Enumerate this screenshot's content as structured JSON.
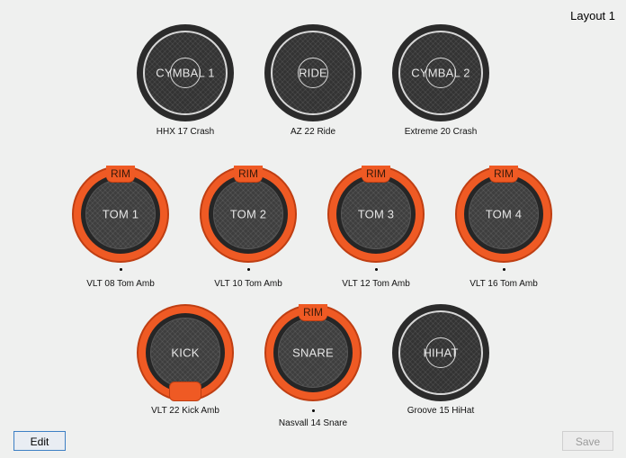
{
  "layout_title": "Layout 1",
  "pads": {
    "cymbal1": {
      "label": "CYMBAL 1",
      "caption": "HHX 17 Crash"
    },
    "ride": {
      "label": "RIDE",
      "caption": "AZ 22 Ride"
    },
    "cymbal2": {
      "label": "CYMBAL 2",
      "caption": "Extreme 20 Crash"
    },
    "tom1": {
      "label": "TOM 1",
      "rim": "RIM",
      "caption": "VLT 08 Tom Amb"
    },
    "tom2": {
      "label": "TOM 2",
      "rim": "RIM",
      "caption": "VLT 10 Tom Amb"
    },
    "tom3": {
      "label": "TOM 3",
      "rim": "RIM",
      "caption": "VLT 12 Tom Amb"
    },
    "tom4": {
      "label": "TOM 4",
      "rim": "RIM",
      "caption": "VLT 16 Tom Amb"
    },
    "kick": {
      "label": "KICK",
      "caption": "VLT 22 Kick Amb"
    },
    "snare": {
      "label": "SNARE",
      "rim": "RIM",
      "caption": "Nasvall 14 Snare"
    },
    "hihat": {
      "label": "HIHAT",
      "caption": "Groove 15 HiHat"
    }
  },
  "buttons": {
    "edit": "Edit",
    "save": "Save"
  },
  "colors": {
    "rim_orange": "#ef5a24",
    "pad_dark": "#3e3e3e",
    "background": "#eff0ef"
  }
}
